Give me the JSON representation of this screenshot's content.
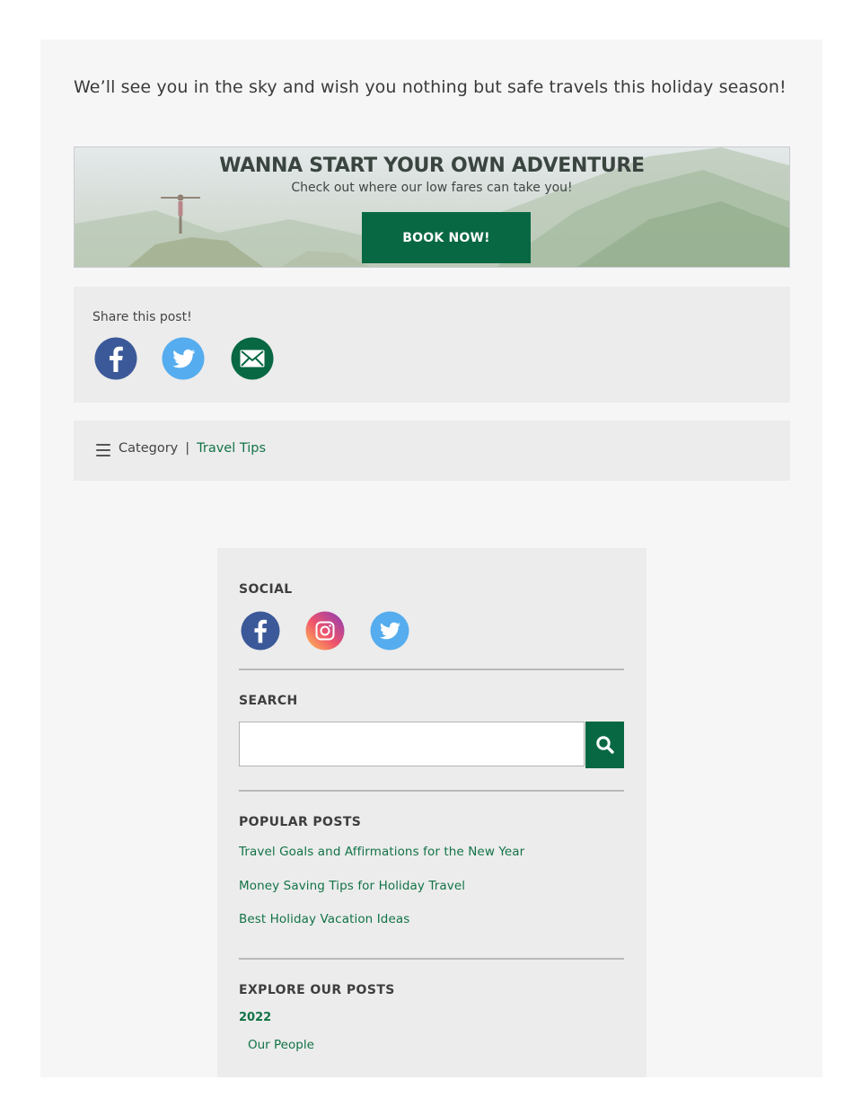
{
  "article": {
    "closing_text": "We’ll see you in the sky and wish you nothing but safe travels this holiday season!"
  },
  "banner": {
    "title": "WANNA START YOUR OWN ADVENTURE",
    "subtitle": "Check out where our low fares can take you!",
    "button_label": "BOOK NOW!"
  },
  "share": {
    "title": "Share this post!",
    "icons": [
      "facebook-icon",
      "twitter-icon",
      "email-icon"
    ]
  },
  "category": {
    "label": "Category",
    "separator": "|",
    "value": "Travel Tips"
  },
  "sidebar": {
    "social": {
      "title": "SOCIAL",
      "icons": [
        "facebook-icon",
        "instagram-icon",
        "twitter-icon"
      ]
    },
    "search": {
      "title": "SEARCH",
      "value": "",
      "placeholder": ""
    },
    "popular": {
      "title": "POPULAR POSTS",
      "items": [
        "Travel Goals and Affirmations for the New Year",
        "Money Saving Tips for Holiday Travel",
        "Best Holiday Vacation Ideas"
      ]
    },
    "explore": {
      "title": "EXPLORE OUR POSTS",
      "year": "2022",
      "sub_item": "Our People"
    }
  },
  "colors": {
    "brand_green": "#086843",
    "link_green": "#127347",
    "facebook_blue": "#3b5998",
    "twitter_blue": "#55acee"
  }
}
